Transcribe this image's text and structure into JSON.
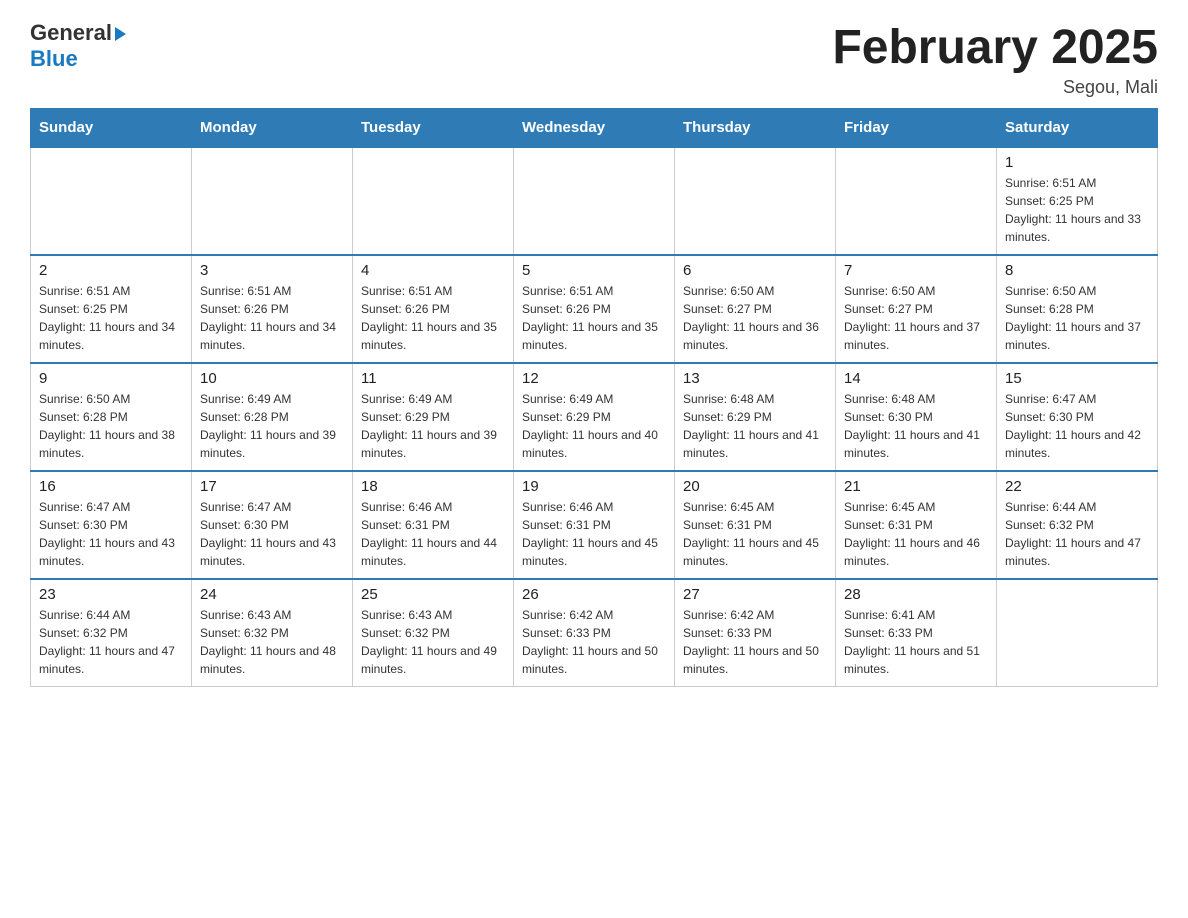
{
  "header": {
    "logo_general": "General",
    "logo_arrow": "▶",
    "logo_blue": "Blue",
    "title": "February 2025",
    "location": "Segou, Mali"
  },
  "weekdays": [
    "Sunday",
    "Monday",
    "Tuesday",
    "Wednesday",
    "Thursday",
    "Friday",
    "Saturday"
  ],
  "weeks": [
    [
      {
        "day": "",
        "info": ""
      },
      {
        "day": "",
        "info": ""
      },
      {
        "day": "",
        "info": ""
      },
      {
        "day": "",
        "info": ""
      },
      {
        "day": "",
        "info": ""
      },
      {
        "day": "",
        "info": ""
      },
      {
        "day": "1",
        "info": "Sunrise: 6:51 AM\nSunset: 6:25 PM\nDaylight: 11 hours and 33 minutes."
      }
    ],
    [
      {
        "day": "2",
        "info": "Sunrise: 6:51 AM\nSunset: 6:25 PM\nDaylight: 11 hours and 34 minutes."
      },
      {
        "day": "3",
        "info": "Sunrise: 6:51 AM\nSunset: 6:26 PM\nDaylight: 11 hours and 34 minutes."
      },
      {
        "day": "4",
        "info": "Sunrise: 6:51 AM\nSunset: 6:26 PM\nDaylight: 11 hours and 35 minutes."
      },
      {
        "day": "5",
        "info": "Sunrise: 6:51 AM\nSunset: 6:26 PM\nDaylight: 11 hours and 35 minutes."
      },
      {
        "day": "6",
        "info": "Sunrise: 6:50 AM\nSunset: 6:27 PM\nDaylight: 11 hours and 36 minutes."
      },
      {
        "day": "7",
        "info": "Sunrise: 6:50 AM\nSunset: 6:27 PM\nDaylight: 11 hours and 37 minutes."
      },
      {
        "day": "8",
        "info": "Sunrise: 6:50 AM\nSunset: 6:28 PM\nDaylight: 11 hours and 37 minutes."
      }
    ],
    [
      {
        "day": "9",
        "info": "Sunrise: 6:50 AM\nSunset: 6:28 PM\nDaylight: 11 hours and 38 minutes."
      },
      {
        "day": "10",
        "info": "Sunrise: 6:49 AM\nSunset: 6:28 PM\nDaylight: 11 hours and 39 minutes."
      },
      {
        "day": "11",
        "info": "Sunrise: 6:49 AM\nSunset: 6:29 PM\nDaylight: 11 hours and 39 minutes."
      },
      {
        "day": "12",
        "info": "Sunrise: 6:49 AM\nSunset: 6:29 PM\nDaylight: 11 hours and 40 minutes."
      },
      {
        "day": "13",
        "info": "Sunrise: 6:48 AM\nSunset: 6:29 PM\nDaylight: 11 hours and 41 minutes."
      },
      {
        "day": "14",
        "info": "Sunrise: 6:48 AM\nSunset: 6:30 PM\nDaylight: 11 hours and 41 minutes."
      },
      {
        "day": "15",
        "info": "Sunrise: 6:47 AM\nSunset: 6:30 PM\nDaylight: 11 hours and 42 minutes."
      }
    ],
    [
      {
        "day": "16",
        "info": "Sunrise: 6:47 AM\nSunset: 6:30 PM\nDaylight: 11 hours and 43 minutes."
      },
      {
        "day": "17",
        "info": "Sunrise: 6:47 AM\nSunset: 6:30 PM\nDaylight: 11 hours and 43 minutes."
      },
      {
        "day": "18",
        "info": "Sunrise: 6:46 AM\nSunset: 6:31 PM\nDaylight: 11 hours and 44 minutes."
      },
      {
        "day": "19",
        "info": "Sunrise: 6:46 AM\nSunset: 6:31 PM\nDaylight: 11 hours and 45 minutes."
      },
      {
        "day": "20",
        "info": "Sunrise: 6:45 AM\nSunset: 6:31 PM\nDaylight: 11 hours and 45 minutes."
      },
      {
        "day": "21",
        "info": "Sunrise: 6:45 AM\nSunset: 6:31 PM\nDaylight: 11 hours and 46 minutes."
      },
      {
        "day": "22",
        "info": "Sunrise: 6:44 AM\nSunset: 6:32 PM\nDaylight: 11 hours and 47 minutes."
      }
    ],
    [
      {
        "day": "23",
        "info": "Sunrise: 6:44 AM\nSunset: 6:32 PM\nDaylight: 11 hours and 47 minutes."
      },
      {
        "day": "24",
        "info": "Sunrise: 6:43 AM\nSunset: 6:32 PM\nDaylight: 11 hours and 48 minutes."
      },
      {
        "day": "25",
        "info": "Sunrise: 6:43 AM\nSunset: 6:32 PM\nDaylight: 11 hours and 49 minutes."
      },
      {
        "day": "26",
        "info": "Sunrise: 6:42 AM\nSunset: 6:33 PM\nDaylight: 11 hours and 50 minutes."
      },
      {
        "day": "27",
        "info": "Sunrise: 6:42 AM\nSunset: 6:33 PM\nDaylight: 11 hours and 50 minutes."
      },
      {
        "day": "28",
        "info": "Sunrise: 6:41 AM\nSunset: 6:33 PM\nDaylight: 11 hours and 51 minutes."
      },
      {
        "day": "",
        "info": ""
      }
    ]
  ]
}
